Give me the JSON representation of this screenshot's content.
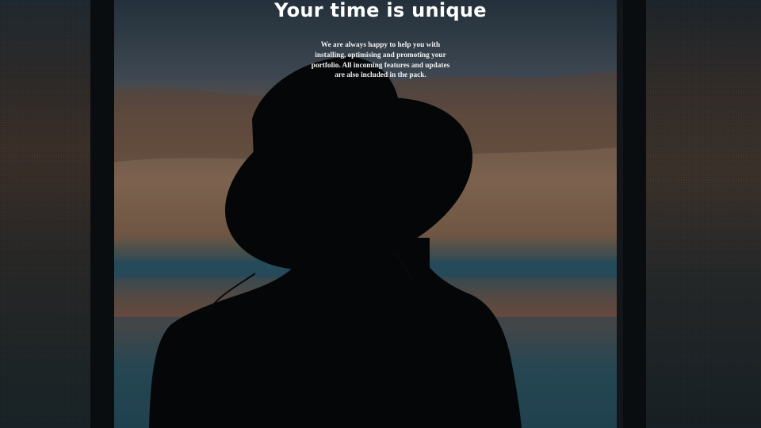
{
  "hero": {
    "headline": "Your time is unique",
    "subtitle": "We are always happy to help you with\ninstalling, optimising and promoting your\nportfolio. All incoming features and updates\nare also included in the pack."
  }
}
